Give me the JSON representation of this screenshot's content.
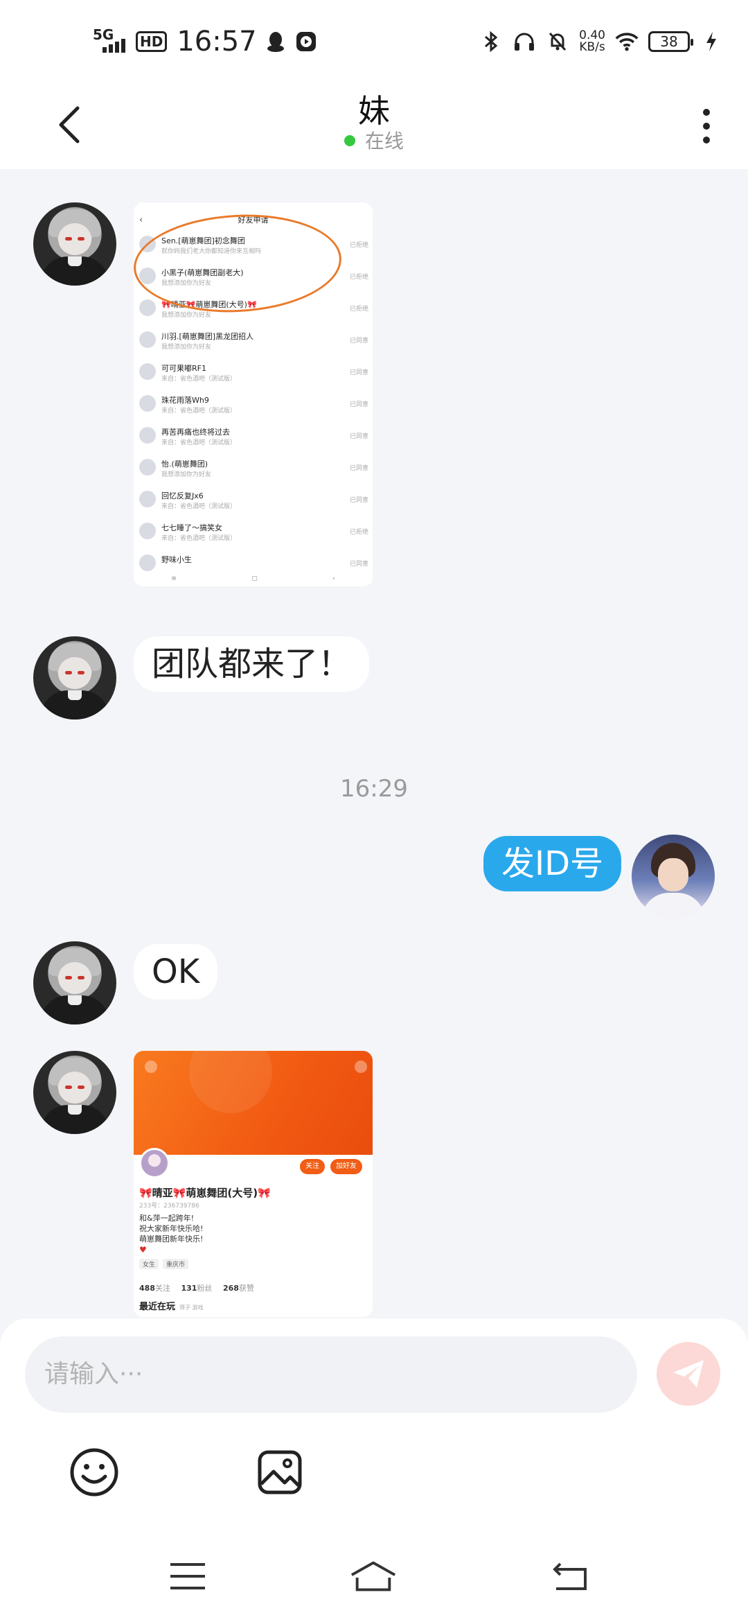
{
  "status_bar": {
    "network": "5G",
    "hd": "HD",
    "time": "16:57",
    "speed_value": "0.40",
    "speed_unit": "KB/s",
    "battery": "38"
  },
  "header": {
    "title": "妹",
    "status": "在线"
  },
  "screenshot1": {
    "title": "好友申请",
    "rows": [
      {
        "name": "Sen.[萌崽舞团]初念舞团",
        "sub": "就你妈我们老大你都知道你来互相吗",
        "status": "已拒绝"
      },
      {
        "name": "小黑子(萌崽舞团副老大)",
        "sub": "我想添加你为好友",
        "status": "已拒绝"
      },
      {
        "name": "🎀晴亚🎀萌崽舞团(大号)🎀",
        "sub": "我想添加你为好友",
        "status": "已拒绝"
      },
      {
        "name": "川羽.[萌崽舞团]黑龙团招人",
        "sub": "我想添加你为好友",
        "status": "已同意"
      },
      {
        "name": "可可果嘟RF1",
        "sub": "来自：省色酒吧（测试版）",
        "status": "已同意"
      },
      {
        "name": "珠花雨落Wh9",
        "sub": "来自：省色酒吧（测试版）",
        "status": "已同意"
      },
      {
        "name": "再苦再痛也终将过去",
        "sub": "来自：省色酒吧（测试版）",
        "status": "已同意"
      },
      {
        "name": "怡.(萌崽舞团)",
        "sub": "我想添加你为好友",
        "status": "已同意"
      },
      {
        "name": "回忆反复Jx6",
        "sub": "来自：省色酒吧（测试版）",
        "status": "已同意"
      },
      {
        "name": "七七睡了～搞笑女",
        "sub": "来自：省色酒吧（测试版）",
        "status": "已拒绝"
      },
      {
        "name": "野味小生",
        "sub": "",
        "status": "已同意"
      }
    ]
  },
  "messages": {
    "msg1": "团队都来了！",
    "time_separator": "16:29",
    "msg2": "发ID号",
    "msg3": "OK"
  },
  "screenshot2": {
    "follow_btn": "关注",
    "add_friend_btn": "加好友",
    "name": "🎀晴亚🎀萌崽舞团(大号)🎀",
    "id": "233号：236739786",
    "bio1": "和&萍一起跨年!",
    "bio2": "祝大家新年快乐哈!",
    "bio3": "萌崽舞团新年快乐!",
    "tag1": "女生",
    "tag2": "重庆市",
    "following_num": "488",
    "following_label": "关注",
    "fans_num": "131",
    "fans_label": "粉丝",
    "likes_num": "268",
    "likes_label": "获赞",
    "recent": "最近在玩",
    "recent_sub": "筛子  游戏"
  },
  "input": {
    "placeholder": "请输入···"
  },
  "icons": {
    "back": "back-arrow-icon",
    "more": "more-vertical-icon",
    "send": "send-plane-icon",
    "emoji": "emoji-smile-icon",
    "image": "image-picker-icon"
  },
  "colors": {
    "outgoing_bubble": "#2aa8ec",
    "online_dot": "#36c93f",
    "send_button": "#fcd9d6",
    "profile_orange": "#f15d14"
  }
}
